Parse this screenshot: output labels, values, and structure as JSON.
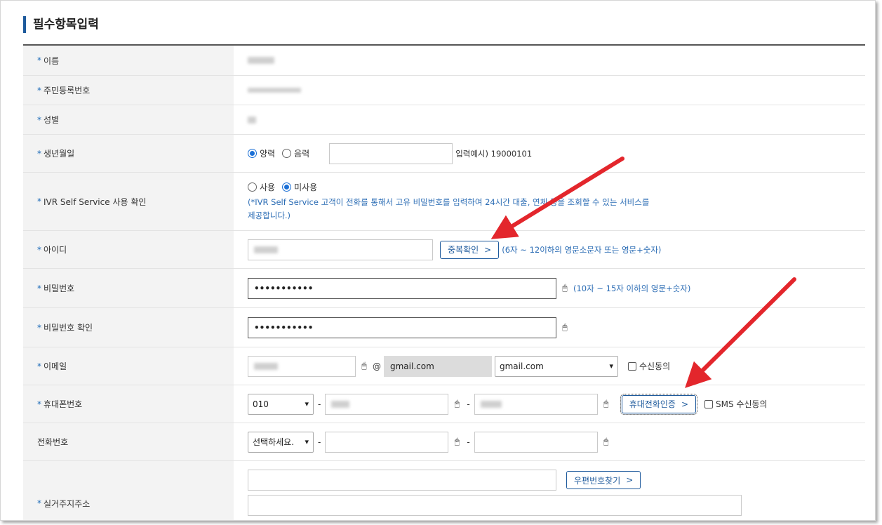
{
  "section_title": "필수항목입력",
  "fields": {
    "name": {
      "label": "이름"
    },
    "rrn": {
      "label": "주민등록번호"
    },
    "gender": {
      "label": "성별"
    },
    "birth": {
      "label": "생년월일",
      "solar": "양력",
      "lunar": "음력",
      "example": "입력예시) 19000101"
    },
    "ivr": {
      "label": "IVR Self Service 사용 확인",
      "use": "사용",
      "nouse": "미사용",
      "desc": "(*IVR Self Service 고객이 전화를 통해서 고유 비밀번호를 입력하여 24시간 대출, 연체 등을 조회할 수 있는 서비스를 제공합니다.)"
    },
    "userid": {
      "label": "아이디",
      "check_button": "중복확인",
      "hint": "(6자 ~ 12이하의 영문소문자 또는 영문+숫자)"
    },
    "password": {
      "label": "비밀번호",
      "value": "•••••••••••",
      "hint": "(10자 ~ 15자 이하의 영문+숫자)"
    },
    "password_confirm": {
      "label": "비밀번호 확인",
      "value": "•••••••••••"
    },
    "email": {
      "label": "이메일",
      "at": "@",
      "domain_value": "gmail.com",
      "domain_select": "gmail.com",
      "consent": "수신동의"
    },
    "mobile": {
      "label": "휴대폰번호",
      "prefix": "010",
      "verify_button": "휴대전화인증",
      "sms_consent": "SMS 수신동의"
    },
    "phone": {
      "label": "전화번호",
      "prefix": "선택하세요."
    },
    "address": {
      "label": "실거주지주소",
      "zip_button": "우편번호찾기"
    }
  },
  "colors": {
    "accent": "#1e5a9c",
    "hint": "#2c6db5",
    "arrow": "#e3262c"
  }
}
